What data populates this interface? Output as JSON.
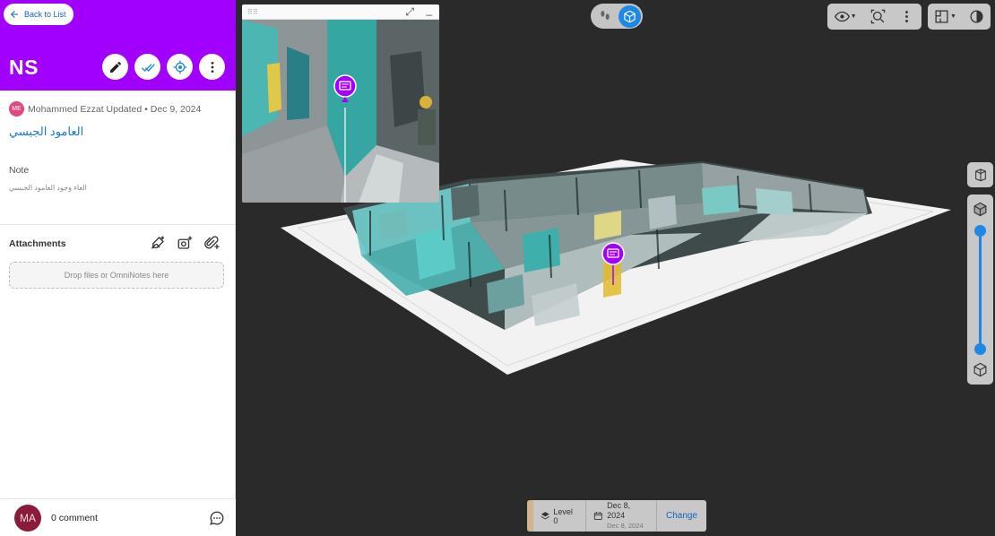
{
  "panel": {
    "back_label": "Back to List",
    "title": "NS",
    "author_initials": "ME",
    "meta": "Mohammed Ezzat Updated • Dec 9, 2024",
    "issue_title": "العامود الجبسي",
    "note_label": "Note",
    "note_text": "الغاء وجود العامود الجبسي",
    "attachments_label": "Attachments",
    "dropzone_text": "Drop files or OmniNotes here",
    "footer_avatar": "MA",
    "comment_count": "0 comment"
  },
  "viewer": {
    "level_label": "Level 0",
    "date_main": "Dec 8, 2024",
    "date_sub": "Dec 8, 2024",
    "change_label": "Change",
    "slider": {
      "upper": 1.0,
      "lower": 0.0
    }
  },
  "colors": {
    "header": "#a100ff",
    "accent": "#1e88e5",
    "marker": "#a100ff"
  },
  "icons": [
    "arrow-left-icon",
    "pencil-icon",
    "double-check-icon",
    "target-icon",
    "more-vertical-icon",
    "add-markup-icon",
    "add-photo-icon",
    "attach-icon",
    "chat-icon",
    "footprints-icon",
    "cube-view-icon",
    "eye-icon",
    "zoom-fit-icon",
    "floor-plan-icon",
    "contrast-icon",
    "map-3d-icon",
    "cube-top-icon",
    "cube-bottom-icon",
    "layers-icon",
    "calendar-icon",
    "note-marker-icon"
  ]
}
